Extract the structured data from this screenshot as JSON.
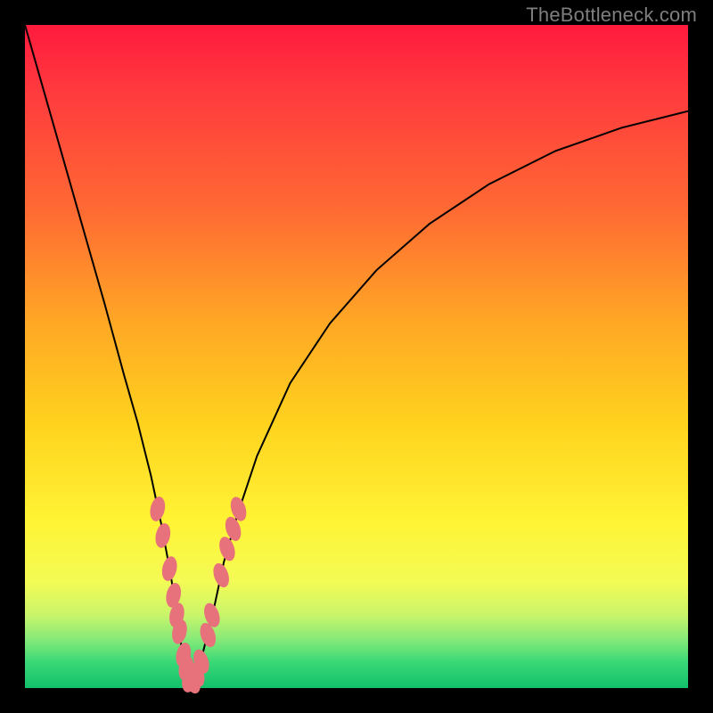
{
  "watermark": "TheBottleneck.com",
  "chart_data": {
    "type": "line",
    "description": "Bottleneck curve: bottleneck percentage vs component performance ratio. Sharp V-shaped minimum near the balanced point, rising steeply on both sides.",
    "xlabel": "",
    "ylabel": "",
    "xlim": [
      0,
      100
    ],
    "ylim": [
      0,
      100
    ],
    "x": [
      0,
      4,
      8,
      12,
      15,
      17,
      19,
      20.5,
      22,
      23,
      23.8,
      24.5,
      25,
      26,
      27,
      28.5,
      30,
      32,
      35,
      40,
      46,
      53,
      61,
      70,
      80,
      90,
      100
    ],
    "y": [
      100,
      86,
      72,
      58,
      47,
      40,
      32,
      25,
      17,
      10,
      5,
      2,
      0,
      2,
      6,
      12,
      19,
      26,
      35,
      46,
      55,
      63,
      70,
      76,
      81,
      84.5,
      87
    ],
    "minimum_x": 25,
    "beads_left": [
      {
        "x": 20.0,
        "y": 27
      },
      {
        "x": 20.8,
        "y": 23
      },
      {
        "x": 21.8,
        "y": 18
      },
      {
        "x": 22.4,
        "y": 14
      },
      {
        "x": 22.9,
        "y": 11
      },
      {
        "x": 23.3,
        "y": 8.5
      },
      {
        "x": 23.9,
        "y": 5
      },
      {
        "x": 24.3,
        "y": 3
      },
      {
        "x": 24.8,
        "y": 1.2
      }
    ],
    "beads_right": [
      {
        "x": 25.3,
        "y": 1.0
      },
      {
        "x": 25.9,
        "y": 2.0
      },
      {
        "x": 26.6,
        "y": 4.0
      },
      {
        "x": 27.6,
        "y": 8.0
      },
      {
        "x": 28.2,
        "y": 11
      },
      {
        "x": 29.6,
        "y": 17
      },
      {
        "x": 30.5,
        "y": 21
      },
      {
        "x": 31.4,
        "y": 24
      },
      {
        "x": 32.2,
        "y": 27
      }
    ]
  }
}
